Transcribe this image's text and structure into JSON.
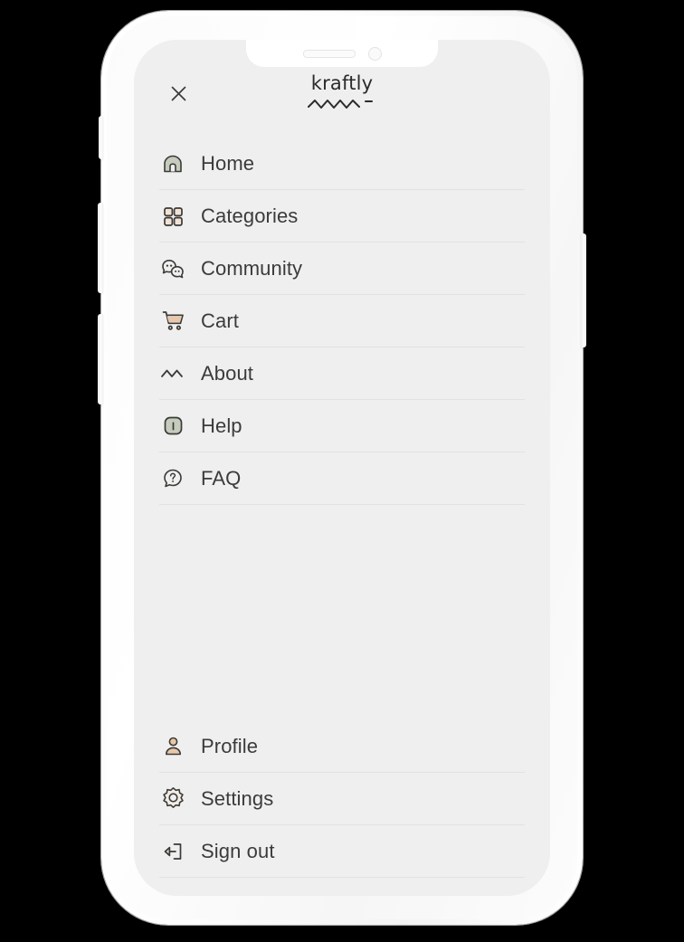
{
  "device": {
    "type": "smartphone-mockup",
    "frame_color": "#ffffff",
    "screen_bg": "#efefef",
    "buttons": [
      {
        "name": "mute-switch"
      },
      {
        "name": "volume-up-button"
      },
      {
        "name": "volume-down-button"
      },
      {
        "name": "power-button"
      }
    ],
    "notch": {
      "speaker": "earpiece-speaker",
      "camera": "front-camera"
    }
  },
  "colors": {
    "text": "#3b3b3b",
    "divider": "#e2e2e2",
    "icon_stroke": "#3a3a36",
    "sage": "#c6ccbd",
    "peach": "#e9c7aa",
    "cream": "#f2e3d5",
    "screen_bg": "#efefef"
  },
  "topbar": {
    "close_label": "close-menu",
    "brand": "kraftly"
  },
  "menu": {
    "primary": [
      {
        "icon": "home-icon",
        "label": "Home"
      },
      {
        "icon": "categories-icon",
        "label": "Categories"
      },
      {
        "icon": "community-icon",
        "label": "Community"
      },
      {
        "icon": "cart-icon",
        "label": "Cart"
      },
      {
        "icon": "about-icon",
        "label": "About"
      },
      {
        "icon": "help-icon",
        "label": "Help"
      },
      {
        "icon": "faq-icon",
        "label": "FAQ"
      }
    ],
    "secondary": [
      {
        "icon": "profile-icon",
        "label": "Profile"
      },
      {
        "icon": "settings-icon",
        "label": "Settings"
      },
      {
        "icon": "sign-out-icon",
        "label": "Sign out"
      }
    ]
  }
}
